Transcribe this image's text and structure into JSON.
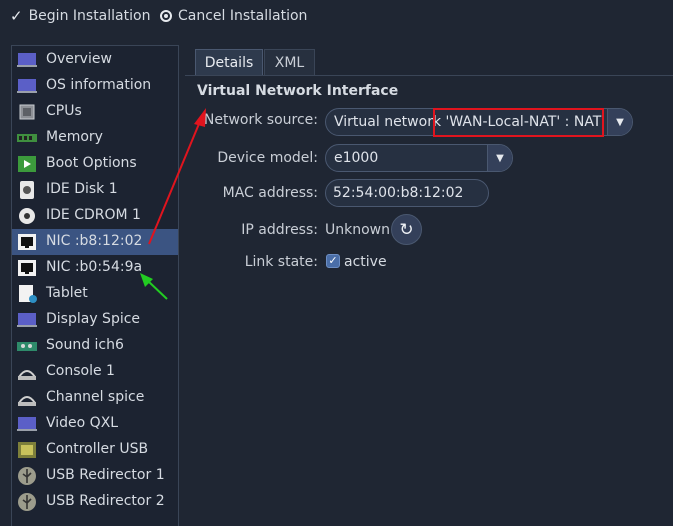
{
  "toolbar": {
    "begin_label": "Begin Installation",
    "cancel_label": "Cancel Installation"
  },
  "sidebar": {
    "items": [
      {
        "label": "Overview",
        "icon": "monitor-icon"
      },
      {
        "label": "OS information",
        "icon": "os-info-icon"
      },
      {
        "label": "CPUs",
        "icon": "cpu-icon"
      },
      {
        "label": "Memory",
        "icon": "memory-icon"
      },
      {
        "label": "Boot Options",
        "icon": "boot-icon"
      },
      {
        "label": "IDE Disk 1",
        "icon": "disk-icon"
      },
      {
        "label": "IDE CDROM 1",
        "icon": "cdrom-icon"
      },
      {
        "label": "NIC :b8:12:02",
        "icon": "nic-icon",
        "selected": true
      },
      {
        "label": "NIC :b0:54:9a",
        "icon": "nic-icon"
      },
      {
        "label": "Tablet",
        "icon": "tablet-icon"
      },
      {
        "label": "Display Spice",
        "icon": "display-icon"
      },
      {
        "label": "Sound ich6",
        "icon": "sound-card-icon"
      },
      {
        "label": "Console 1",
        "icon": "serial-icon"
      },
      {
        "label": "Channel spice",
        "icon": "serial-icon"
      },
      {
        "label": "Video QXL",
        "icon": "video-icon"
      },
      {
        "label": "Controller USB",
        "icon": "controller-icon"
      },
      {
        "label": "USB Redirector 1",
        "icon": "usb-icon"
      },
      {
        "label": "USB Redirector 2",
        "icon": "usb-icon"
      }
    ]
  },
  "tabs": [
    {
      "label": "Details",
      "active": true
    },
    {
      "label": "XML",
      "active": false
    }
  ],
  "details": {
    "section_title": "Virtual Network Interface",
    "network_source_label": "Network source:",
    "network_source_value": "Virtual network 'WAN-Local-NAT' : NAT",
    "device_model_label": "Device model:",
    "device_model_value": "e1000",
    "mac_label": "MAC address:",
    "mac_value": "52:54:00:b8:12:02",
    "ip_label": "IP address:",
    "ip_value": "Unknown",
    "link_label": "Link state:",
    "link_value": "active"
  },
  "colors": {
    "background": "#1f2633",
    "selection": "#3b5482",
    "annotation_red": "#e0141e",
    "annotation_green": "#22cc22"
  }
}
